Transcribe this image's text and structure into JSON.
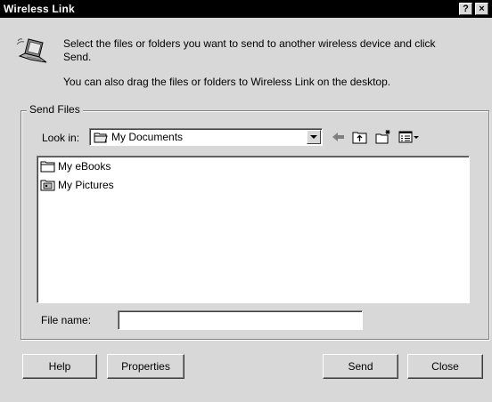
{
  "window": {
    "title": "Wireless Link",
    "help_button": "?",
    "close_button": "×"
  },
  "intro": {
    "line1": "Select the files or folders you want to send to another wireless device and click",
    "line2": "Send.",
    "line3": "You can also drag the files or folders to Wireless Link on the desktop."
  },
  "send_files": {
    "group_label": "Send Files",
    "look_in_label": "Look in:",
    "look_in_value": "My Documents",
    "items": [
      {
        "label": "My eBooks",
        "icon": "folder-icon"
      },
      {
        "label": "My Pictures",
        "icon": "pictures-folder-icon"
      }
    ],
    "file_name_label": "File name:",
    "file_name_value": ""
  },
  "buttons": {
    "help": "Help",
    "properties": "Properties",
    "send": "Send",
    "close": "Close"
  },
  "toolbar_icons": [
    "back-arrow-icon",
    "up-folder-icon",
    "new-folder-icon",
    "view-menu-icon"
  ]
}
